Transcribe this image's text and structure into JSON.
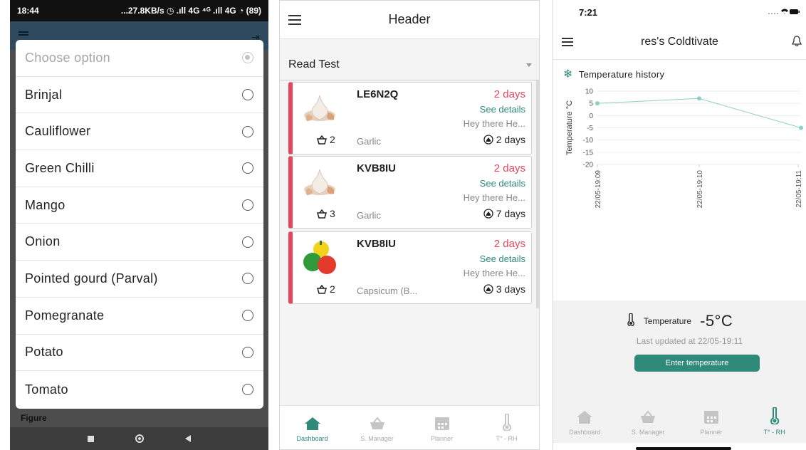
{
  "phone1": {
    "status_time": "18:44",
    "status_right": "...27.8KB/s ◷ .ıll 4G ⁴ᴳ .ıll 4G ◔ (89)",
    "dialog": {
      "header": "Choose option",
      "options": [
        "Brinjal",
        "Cauliflower",
        "Green Chilli",
        "Mango",
        "Onion",
        "Pointed gourd (Parval)",
        "Pomegranate",
        "Potato",
        "Tomato"
      ]
    },
    "figure_label": "Figure"
  },
  "phone2": {
    "header_title": "Header",
    "select_value": "Read Test",
    "cards": [
      {
        "code": "LE6N2Q",
        "due": "2 days",
        "see_details": "See details",
        "message": "Hey there He...",
        "quantity": "2",
        "product": "Garlic",
        "storage": "2 days",
        "image": "garlic-icon"
      },
      {
        "code": "KVB8IU",
        "due": "2 days",
        "see_details": "See details",
        "message": "Hey there He...",
        "quantity": "3",
        "product": "Garlic",
        "storage": "7 days",
        "image": "garlic-icon"
      },
      {
        "code": "KVB8IU",
        "due": "2 days",
        "see_details": "See details",
        "message": "Hey there He...",
        "quantity": "2",
        "product": "Capsicum (B...",
        "storage": "3 days",
        "image": "capsicum-icon"
      }
    ],
    "tabs": [
      {
        "label": "Dashboard",
        "icon": "home-icon",
        "active": true
      },
      {
        "label": "S. Manager",
        "icon": "basket-icon",
        "active": false
      },
      {
        "label": "Planner",
        "icon": "calendar-icon",
        "active": false
      },
      {
        "label": "T° - RH",
        "icon": "thermometer-icon",
        "active": false
      }
    ],
    "colors": {
      "accent": "#2f8a7a",
      "alert": "#e8455c"
    }
  },
  "phone3": {
    "status_time": "7:21",
    "header_title": "res's Coldtivate",
    "section_title": "Temperature history",
    "temperature_label": "Temperature",
    "temperature_value": "-5°C",
    "last_updated": "Last updated at 22/05-19:11",
    "enter_button": "Enter temperature",
    "tabs": [
      {
        "label": "Dashboard",
        "icon": "home-icon",
        "active": false
      },
      {
        "label": "S. Manager",
        "icon": "basket-icon",
        "active": false
      },
      {
        "label": "Planner",
        "icon": "calendar-icon",
        "active": false
      },
      {
        "label": "T° - RH",
        "icon": "thermometer-icon",
        "active": true
      }
    ]
  },
  "chart_data": {
    "type": "line",
    "title": "Temperature history",
    "ylabel": "Temperature °C",
    "x": [
      "22/05-19:09",
      "22/05-19:10",
      "22/05-19:11"
    ],
    "values": [
      5,
      7,
      -5
    ],
    "yticks": [
      10,
      5,
      0,
      -5,
      -10,
      -15,
      -20
    ],
    "ylim": [
      -20,
      10
    ],
    "grid": true,
    "line_color": "#8fcfc3"
  }
}
